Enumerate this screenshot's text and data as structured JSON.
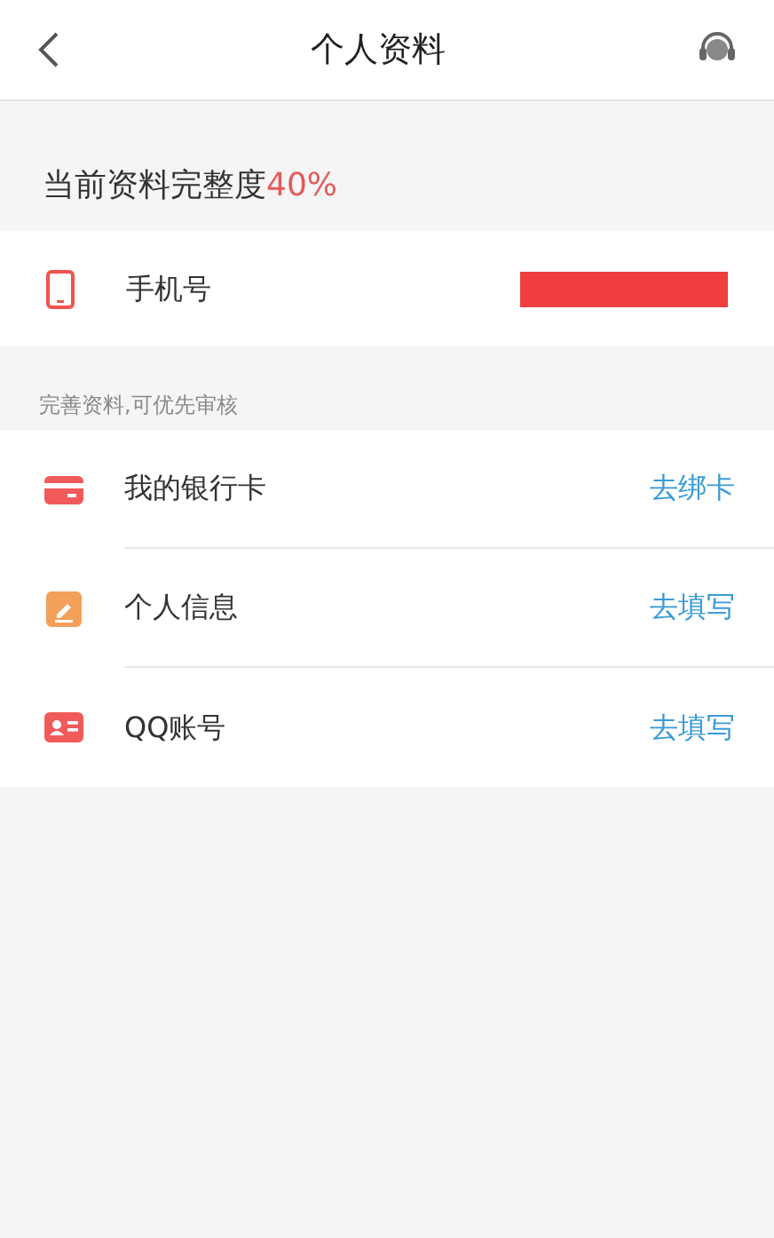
{
  "header": {
    "title": "个人资料"
  },
  "completeness": {
    "label": "当前资料完整度",
    "value": "40%"
  },
  "phone": {
    "label": "手机号",
    "redacted": true
  },
  "hint": "完善资料,可优先审核",
  "items": [
    {
      "kind": "card",
      "label": "我的银行卡",
      "action": "去绑卡"
    },
    {
      "kind": "edit",
      "label": "个人信息",
      "action": "去填写"
    },
    {
      "kind": "id",
      "label": "QQ账号",
      "action": "去填写"
    }
  ]
}
